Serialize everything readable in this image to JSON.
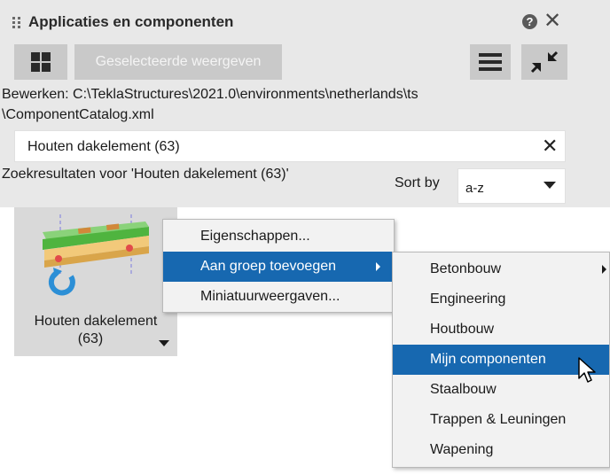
{
  "window": {
    "title": "Applicaties en componenten",
    "help_glyph": "?",
    "close_glyph": "✕"
  },
  "toolbar": {
    "selected_view_label": "Geselecteerde weergeven"
  },
  "path": {
    "line1": "Bewerken:   C:\\TeklaStructures\\2021.0\\environments\\netherlands\\ts",
    "line2": "\\ComponentCatalog.xml"
  },
  "search": {
    "value": "Houten dakelement (63)",
    "clear_glyph": "✕"
  },
  "results": {
    "label": "Zoekresultaten voor 'Houten dakelement (63)'",
    "sort_label": "Sort by",
    "sort_value": "a-z"
  },
  "tile": {
    "name_line1": "Houten dakelement",
    "name_line2": "(63)"
  },
  "context_menu": {
    "items": [
      {
        "label": "Eigenschappen..."
      },
      {
        "label": "Aan groep toevoegen"
      },
      {
        "label": "Miniatuurweergaven..."
      }
    ]
  },
  "submenu": {
    "items": [
      {
        "label": "Betonbouw"
      },
      {
        "label": "Engineering"
      },
      {
        "label": "Houtbouw"
      },
      {
        "label": "Mijn componenten"
      },
      {
        "label": "Staalbouw"
      },
      {
        "label": "Trappen & Leuningen"
      },
      {
        "label": "Wapening"
      }
    ]
  },
  "colors": {
    "accent": "#1768b0",
    "panel_bg": "#e8e8e8",
    "button_bg": "#c9c9c9"
  }
}
